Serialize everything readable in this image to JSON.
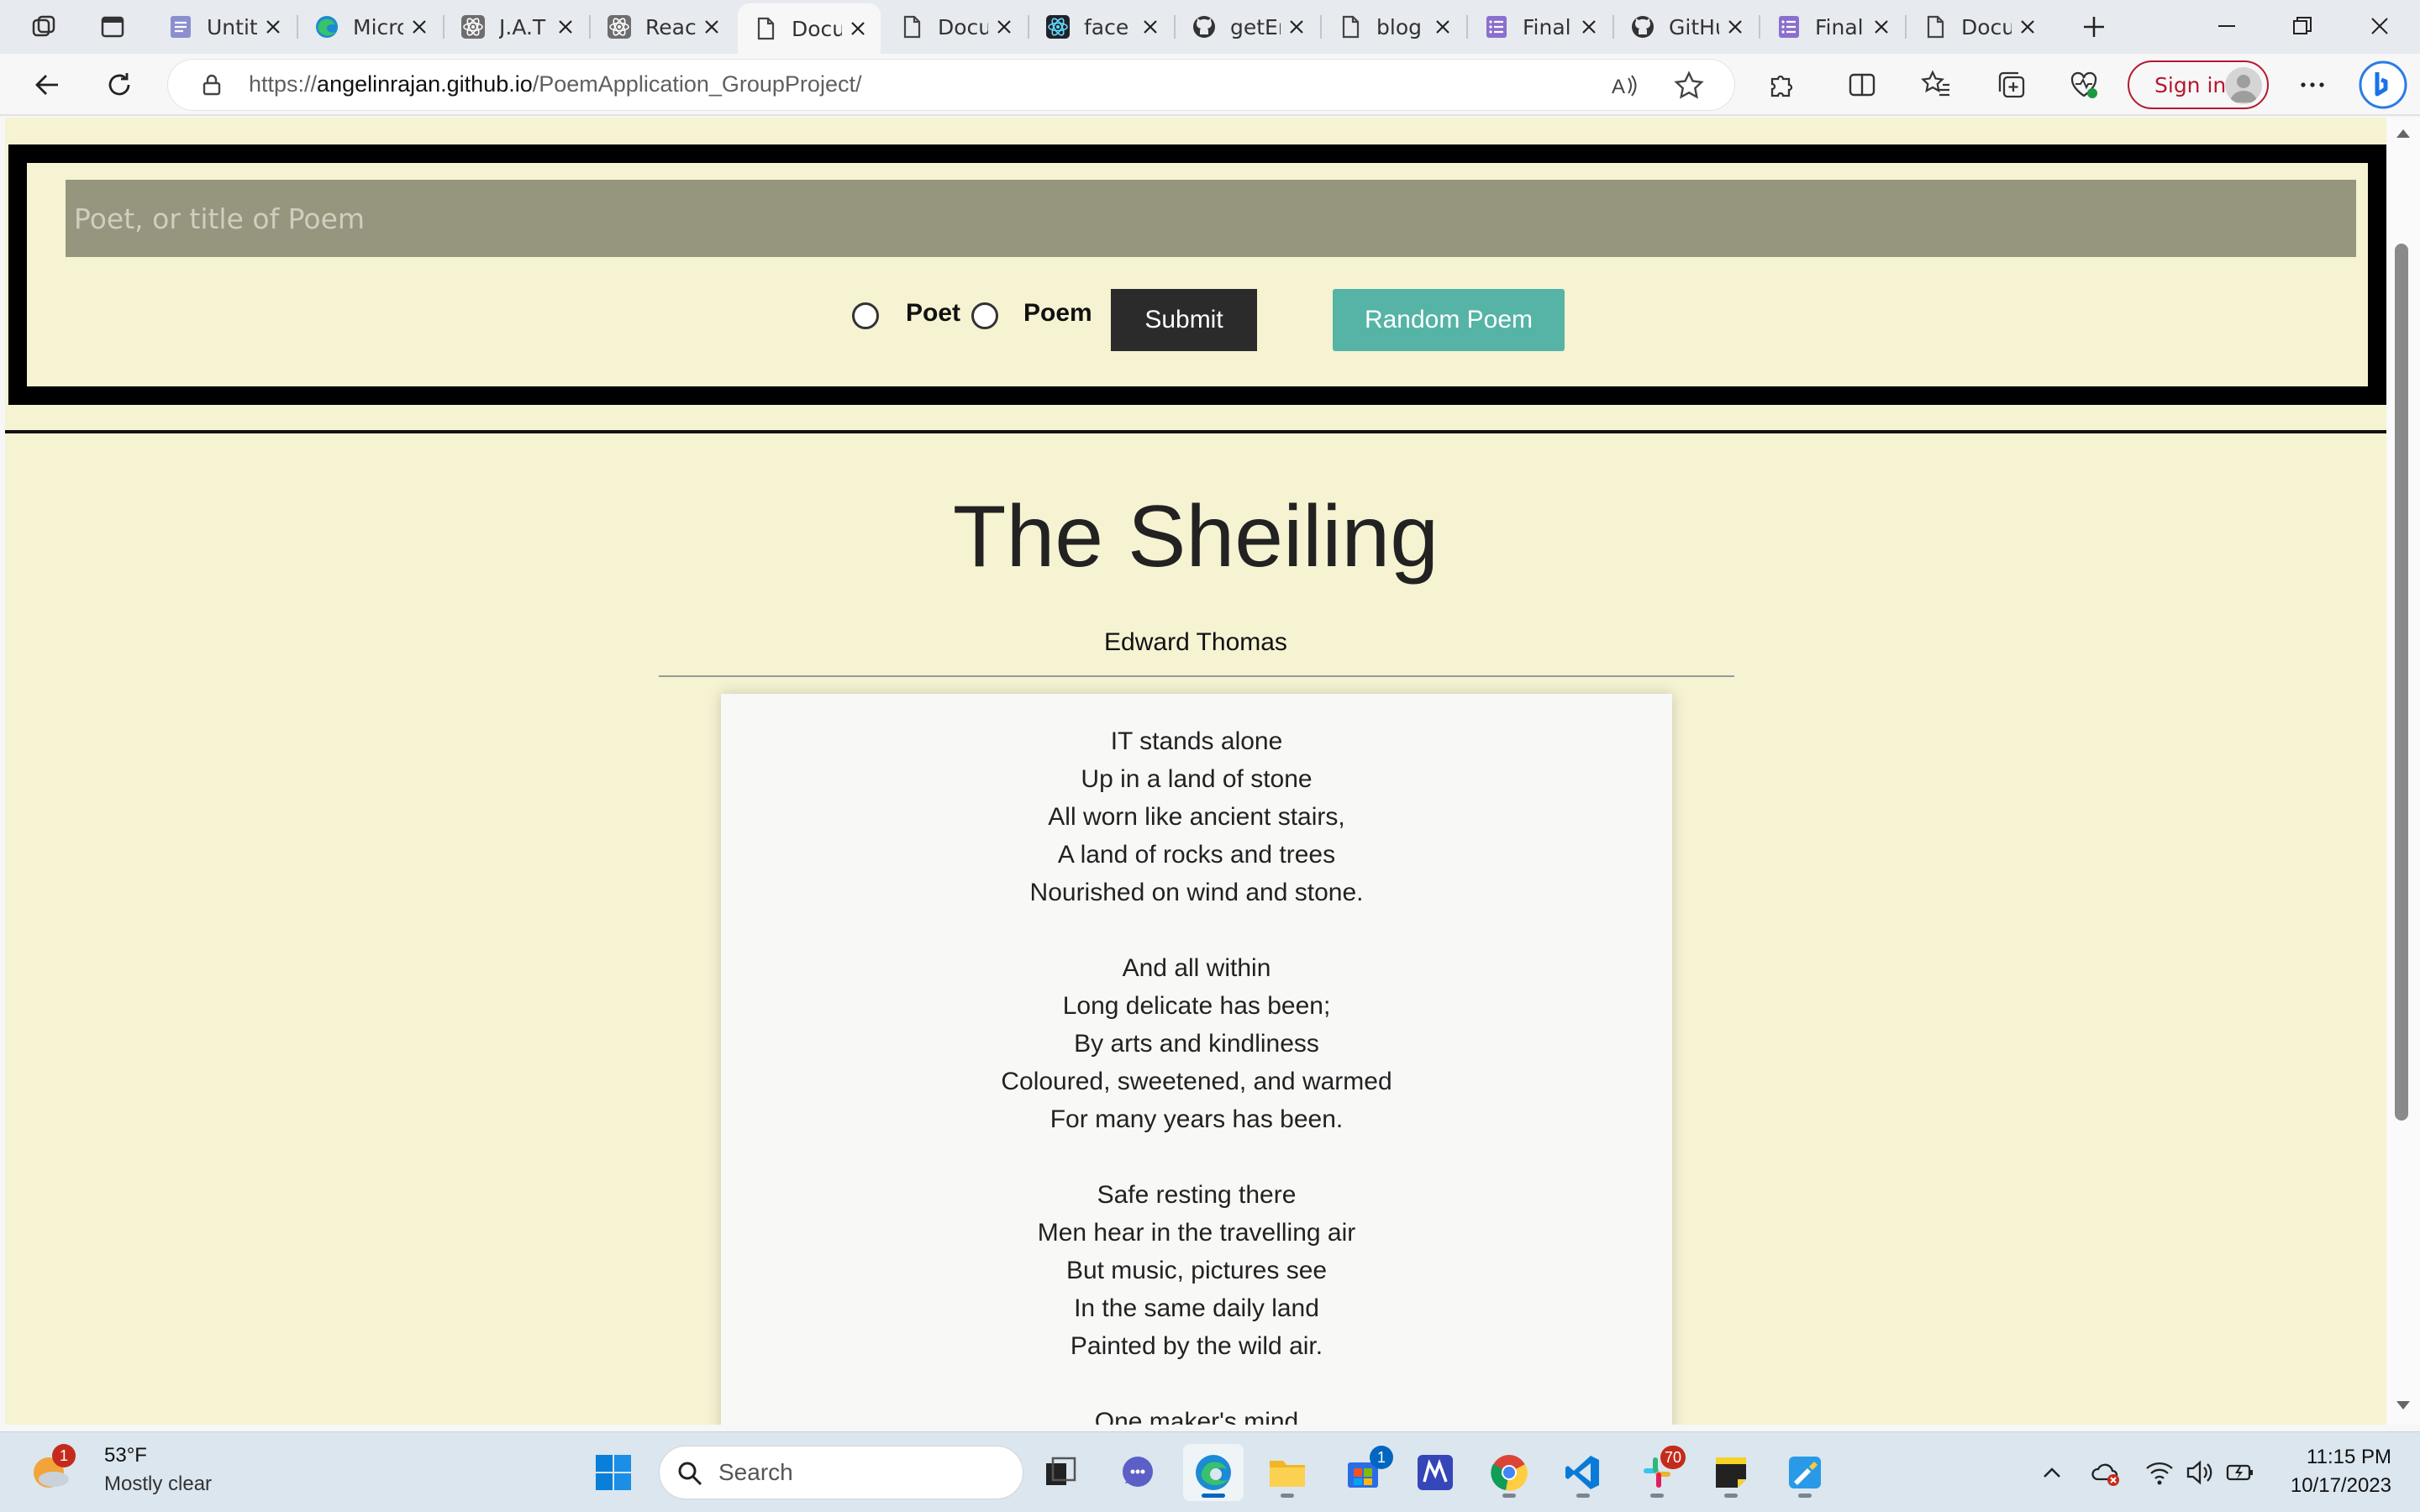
{
  "browser": {
    "tabs": [
      {
        "title": "Untitled",
        "icon": "doc-lines-icon",
        "active": false
      },
      {
        "title": "Microsoft",
        "icon": "edge-icon",
        "active": false
      },
      {
        "title": "J.A.T",
        "icon": "react-icon",
        "active": false
      },
      {
        "title": "React",
        "icon": "react-icon",
        "active": false
      },
      {
        "title": "Document",
        "icon": "page-icon",
        "active": true
      },
      {
        "title": "Document",
        "icon": "page-icon",
        "active": false
      },
      {
        "title": "face",
        "icon": "react-dark-icon",
        "active": false
      },
      {
        "title": "getEmoji",
        "icon": "github-icon",
        "active": false
      },
      {
        "title": "blog",
        "icon": "page-icon",
        "active": false
      },
      {
        "title": "Final",
        "icon": "list-icon",
        "active": false
      },
      {
        "title": "GitHub",
        "icon": "github-icon",
        "active": false
      },
      {
        "title": "Final",
        "icon": "list-icon",
        "active": false
      },
      {
        "title": "Document",
        "icon": "page-icon",
        "active": false
      }
    ],
    "url": {
      "prefix": "https://",
      "host": "angelinrajan.github.io",
      "path": "/PoemApplication_GroupProject/"
    },
    "signin_label": "Sign in"
  },
  "search": {
    "placeholder": "Poet, or title of Poem",
    "value": "",
    "radio_poet_label": "Poet",
    "radio_poem_label": "Poem",
    "submit_label": "Submit",
    "random_label": "Random Poem"
  },
  "poem": {
    "title": "The Sheiling",
    "author": "Edward Thomas",
    "lines": [
      "IT stands alone",
      "Up in a land of stone",
      "All worn like ancient stairs,",
      "A land of rocks and trees",
      "Nourished on wind and stone.",
      "",
      "And all within",
      "Long delicate has been;",
      "By arts and kindliness",
      "Coloured, sweetened, and warmed",
      "For many years has been.",
      "",
      "Safe resting there",
      "Men hear in the travelling air",
      "But music, pictures see",
      "In the same daily land",
      "Painted by the wild air.",
      "",
      "One maker's mind"
    ]
  },
  "taskbar": {
    "weather": {
      "temp": "53°F",
      "desc": "Mostly clear",
      "badge": "1"
    },
    "search_placeholder": "Search",
    "store_badge": "1",
    "slack_badge": "70",
    "clock": {
      "time": "11:15 PM",
      "date": "10/17/2023"
    }
  },
  "colors": {
    "page_bg": "#f5f3d2",
    "input_bg": "#96957d",
    "submit_bg": "#2b2b2b",
    "random_bg": "#55b4a6",
    "signin_accent": "#b5182f"
  }
}
